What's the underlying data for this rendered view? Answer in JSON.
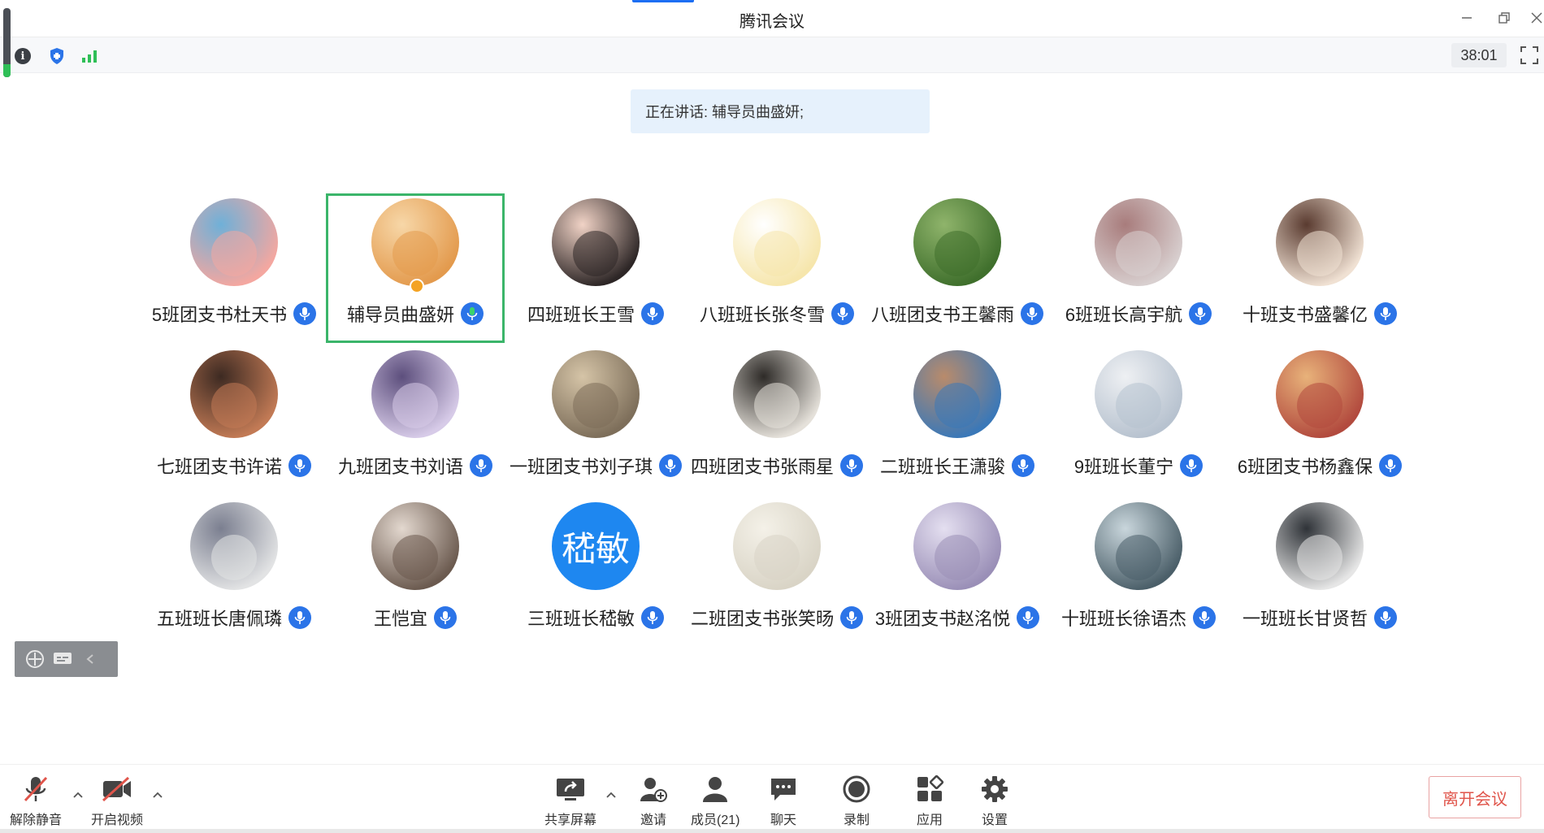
{
  "window": {
    "title": "腾讯会议",
    "minimize_icon": "minimize-icon",
    "restore_icon": "restore-icon",
    "close_icon": "close-icon"
  },
  "infobar": {
    "timer": "38:01",
    "icons": [
      "info-icon",
      "shield-icon",
      "signal-icon",
      "fullscreen-icon"
    ]
  },
  "speaking": {
    "text": "正在讲话: 辅导员曲盛妍;"
  },
  "participants": [
    {
      "name": "5班团支书杜天书",
      "active": false,
      "avatar_colors": [
        "#f4a7a0",
        "#6fb0d8"
      ]
    },
    {
      "name": "辅导员曲盛妍",
      "active": true,
      "avatar_colors": [
        "#e39a4d",
        "#f7d7a8"
      ]
    },
    {
      "name": "四班班长王雪",
      "active": false,
      "avatar_colors": [
        "#2d2626",
        "#f1d3c6"
      ]
    },
    {
      "name": "八班班长张冬雪",
      "active": false,
      "avatar_colors": [
        "#f6e6ac",
        "#ffffff"
      ]
    },
    {
      "name": "八班团支书王馨雨",
      "active": false,
      "avatar_colors": [
        "#3f6f2c",
        "#8fb46b"
      ]
    },
    {
      "name": "6班班长高宇航",
      "active": false,
      "avatar_colors": [
        "#d8cfcf",
        "#a87c7c"
      ]
    },
    {
      "name": "十班支书盛馨亿",
      "active": false,
      "avatar_colors": [
        "#f0e1d3",
        "#5a3b30"
      ]
    },
    {
      "name": "七班团支书许诺",
      "active": false,
      "avatar_colors": [
        "#c27a55",
        "#3d2a22"
      ]
    },
    {
      "name": "九班团支书刘语",
      "active": false,
      "avatar_colors": [
        "#d7cbe8",
        "#5d4f7d"
      ]
    },
    {
      "name": "一班团支书刘子琪",
      "active": false,
      "avatar_colors": [
        "#7d6e5a",
        "#d5c4a7"
      ]
    },
    {
      "name": "四班团支书张雨星",
      "active": false,
      "avatar_colors": [
        "#e5e1da",
        "#2e2b28"
      ]
    },
    {
      "name": "二班班长王潇骏",
      "active": false,
      "avatar_colors": [
        "#3a78b8",
        "#b98b6b"
      ]
    },
    {
      "name": "9班班长董宁",
      "active": false,
      "avatar_colors": [
        "#b7c2cf",
        "#eef0f3"
      ]
    },
    {
      "name": "6班团支书杨鑫保",
      "active": false,
      "avatar_colors": [
        "#b24a3e",
        "#e8b27a"
      ]
    },
    {
      "name": "五班班长唐佩璘",
      "active": false,
      "avatar_colors": [
        "#e2e3e4",
        "#7b7f90"
      ]
    },
    {
      "name": "王恺宜",
      "active": false,
      "avatar_colors": [
        "#6b5a4f",
        "#e3d8cf"
      ]
    },
    {
      "name": "三班班长嵇敏",
      "active": false,
      "avatar_text": "嵇敏",
      "avatar_colors": [
        "#1e87f0",
        "#1e87f0"
      ]
    },
    {
      "name": "二班团支书张笑旸",
      "active": false,
      "avatar_colors": [
        "#d9d4c6",
        "#f4f1e8"
      ]
    },
    {
      "name": "3班团支书赵洺悦",
      "active": false,
      "avatar_colors": [
        "#9a8fb7",
        "#e4dff0"
      ]
    },
    {
      "name": "十班班长徐语杰",
      "active": false,
      "avatar_colors": [
        "#4b5f69",
        "#c9d6dc"
      ]
    },
    {
      "name": "一班班长甘贤哲",
      "active": false,
      "avatar_colors": [
        "#e6e6e6",
        "#2f3338"
      ]
    }
  ],
  "toolbar": {
    "unmute": "解除静音",
    "start_video": "开启视频",
    "share_screen": "共享屏幕",
    "invite": "邀请",
    "members": "成员(21)",
    "chat": "聊天",
    "record": "录制",
    "apps": "应用",
    "settings": "设置",
    "leave": "离开会议"
  },
  "colors": {
    "accent": "#1c6ef3",
    "active_border": "#3bb56a",
    "leave": "#e0554b",
    "mic_badge": "#2b74e8"
  }
}
